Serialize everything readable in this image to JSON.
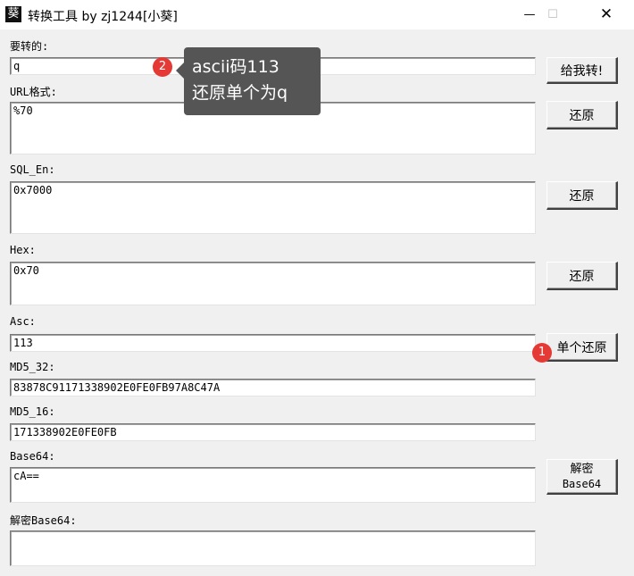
{
  "window": {
    "title": "转换工具 by zj1244[小葵]",
    "icon_glyph": "葵",
    "minimize": "—",
    "maximize": "☐",
    "close": "✕"
  },
  "fields": {
    "input": {
      "label": "要转的:",
      "value": "q"
    },
    "url": {
      "label": "URL格式:",
      "value": "%70"
    },
    "sql_en": {
      "label": "SQL_En:",
      "value": "0x7000"
    },
    "hex": {
      "label": "Hex:",
      "value": "0x70"
    },
    "asc": {
      "label": "Asc:",
      "value": "113"
    },
    "md5_32": {
      "label": "MD5_32:",
      "value": "83878C91171338902E0FE0FB97A8C47A"
    },
    "md5_16": {
      "label": "MD5_16:",
      "value": "171338902E0FE0FB"
    },
    "base64": {
      "label": "Base64:",
      "value": "cA=="
    },
    "decode_base64": {
      "label": "解密Base64:",
      "value": ""
    }
  },
  "buttons": {
    "convert": "给我转!",
    "restore_url": "还原",
    "restore_sql": "还原",
    "restore_hex": "还原",
    "restore_single": "单个还原",
    "decode_line1": "解密",
    "decode_line2": "Base64"
  },
  "annotations": {
    "badge1": "1",
    "badge2": "2",
    "tooltip_line1": "ascii码113",
    "tooltip_line2": "还原单个为q",
    "badge_color": "#e53935",
    "tooltip_color": "#555555"
  }
}
